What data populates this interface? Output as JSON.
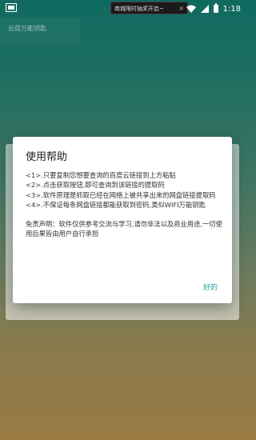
{
  "status_bar": {
    "ad_text": "商城限时抽奖开启~",
    "ad_close": "×",
    "time": "1:18"
  },
  "app": {
    "title": "云盘万能钥匙"
  },
  "dialog": {
    "title": "使用帮助",
    "lines": [
      "<1>.只要复制您想要查询的百度云链接到上方粘贴",
      "<2>.点击获取按钮,即可查询到该链接的提取码",
      "<3>.软件原理是抓取已经在网络上被共享出来的网盘链接提取码",
      "<4>.不保证每条网盘链接都能获取到密码,类似WIFI万能钥匙"
    ],
    "disclaimer": "免责声明：软件仅供参考交流与学习,请勿非法以及商业用途,一切使用后果皆由用户自行承担",
    "ok_label": "好的"
  }
}
